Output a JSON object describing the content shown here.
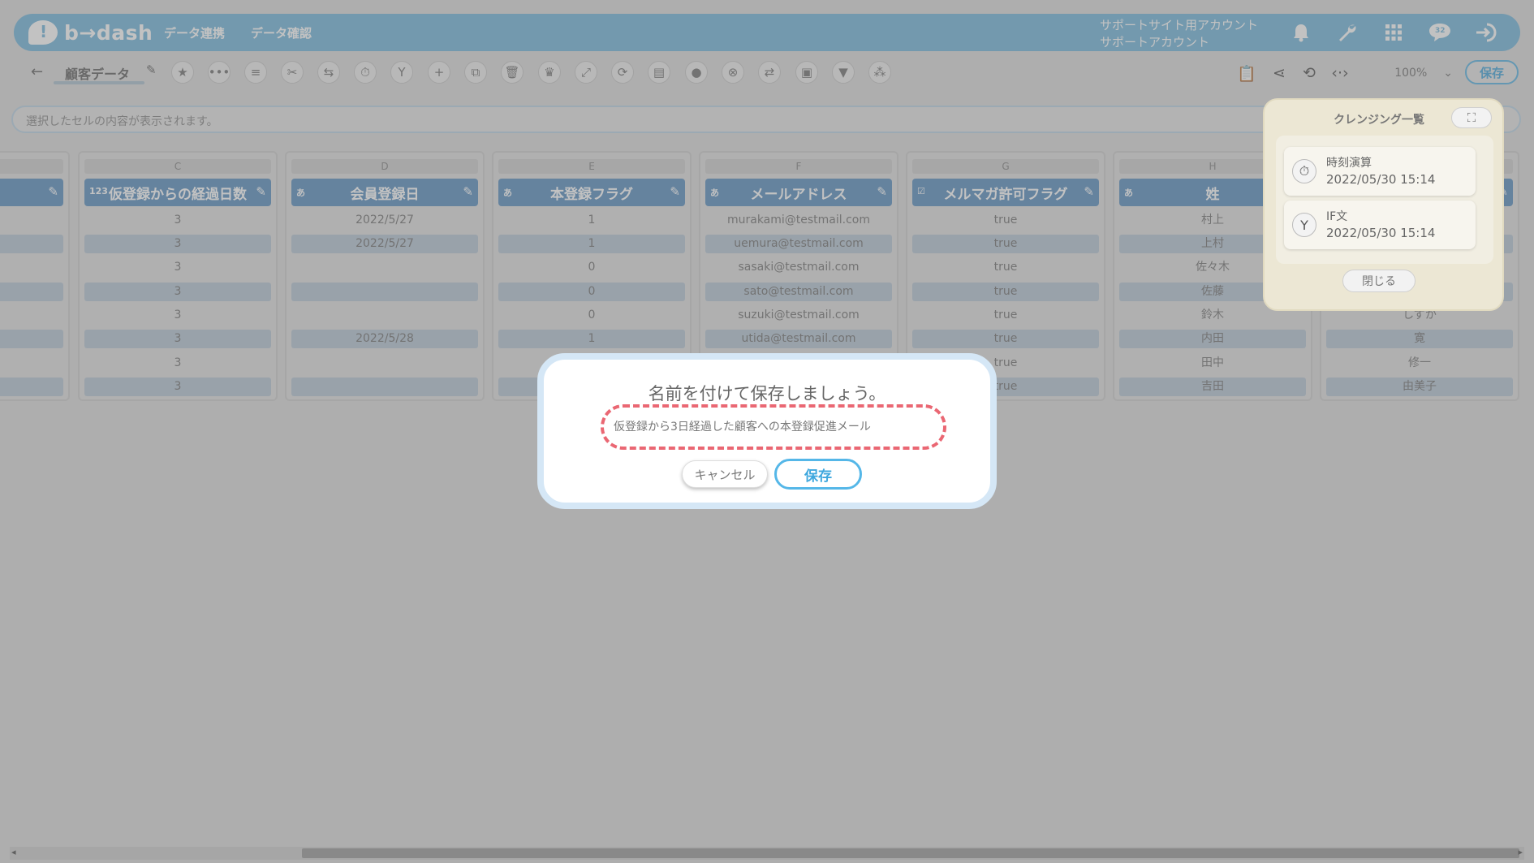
{
  "header": {
    "logo_text": "b→dash",
    "nav": [
      "データ連携",
      "データ確認"
    ],
    "account_line1": "サポートサイト用アカウント",
    "account_line2": "サポートアカウント",
    "chat_badge": "32"
  },
  "toolbar": {
    "sheet_name": "顧客データ",
    "zoom": "100%",
    "save_label": "保存"
  },
  "cellbar": {
    "placeholder": "選択したセルの内容が表示されます。"
  },
  "columns": [
    {
      "letter": "",
      "name": "",
      "type": "",
      "cells": [
        "",
        "",
        "",
        "",
        "",
        "",
        "",
        ""
      ]
    },
    {
      "letter": "C",
      "name": "仮登録からの経過日数",
      "type": "123",
      "cells": [
        "3",
        "3",
        "3",
        "3",
        "3",
        "3",
        "3",
        "3"
      ]
    },
    {
      "letter": "D",
      "name": "会員登録日",
      "type": "あ",
      "cells": [
        "2022/5/27",
        "2022/5/27",
        "",
        "",
        "",
        "2022/5/28",
        "",
        ""
      ]
    },
    {
      "letter": "E",
      "name": "本登録フラグ",
      "type": "あ",
      "cells": [
        "1",
        "1",
        "0",
        "0",
        "0",
        "1",
        "",
        ""
      ]
    },
    {
      "letter": "F",
      "name": "メールアドレス",
      "type": "あ",
      "cells": [
        "murakami@testmail.com",
        "uemura@testmail.com",
        "sasaki@testmail.com",
        "sato@testmail.com",
        "suzuki@testmail.com",
        "utida@testmail.com",
        "",
        ""
      ]
    },
    {
      "letter": "G",
      "name": "メルマガ許可フラグ",
      "type": "☑",
      "cells": [
        "true",
        "true",
        "true",
        "true",
        "true",
        "true",
        "true",
        "true"
      ]
    },
    {
      "letter": "H",
      "name": "姓",
      "type": "あ",
      "cells": [
        "村上",
        "上村",
        "佐々木",
        "佐藤",
        "鈴木",
        "内田",
        "田中",
        "吉田"
      ]
    },
    {
      "letter": "",
      "name": "",
      "type": "",
      "cells": [
        "",
        "",
        "",
        "",
        "しずか",
        "寛",
        "修一",
        "由美子"
      ]
    }
  ],
  "cleansing": {
    "title": "クレンジング一覧",
    "items": [
      {
        "name": "時刻演算",
        "time": "2022/05/30 15:14",
        "icon": "stopwatch-icon"
      },
      {
        "name": "IF文",
        "time": "2022/05/30 15:14",
        "icon": "branch-icon"
      }
    ],
    "close_label": "閉じる"
  },
  "modal": {
    "title": "名前を付けて保存しましょう。",
    "input_value": "仮登録から3日経過した顧客への本登録促進メール",
    "cancel_label": "キャンセル",
    "save_label": "保存"
  },
  "colors": {
    "header": "#78b9dd",
    "column_header": "#5f93c2",
    "accent": "#55b7e8",
    "highlight": "#ea6773"
  }
}
